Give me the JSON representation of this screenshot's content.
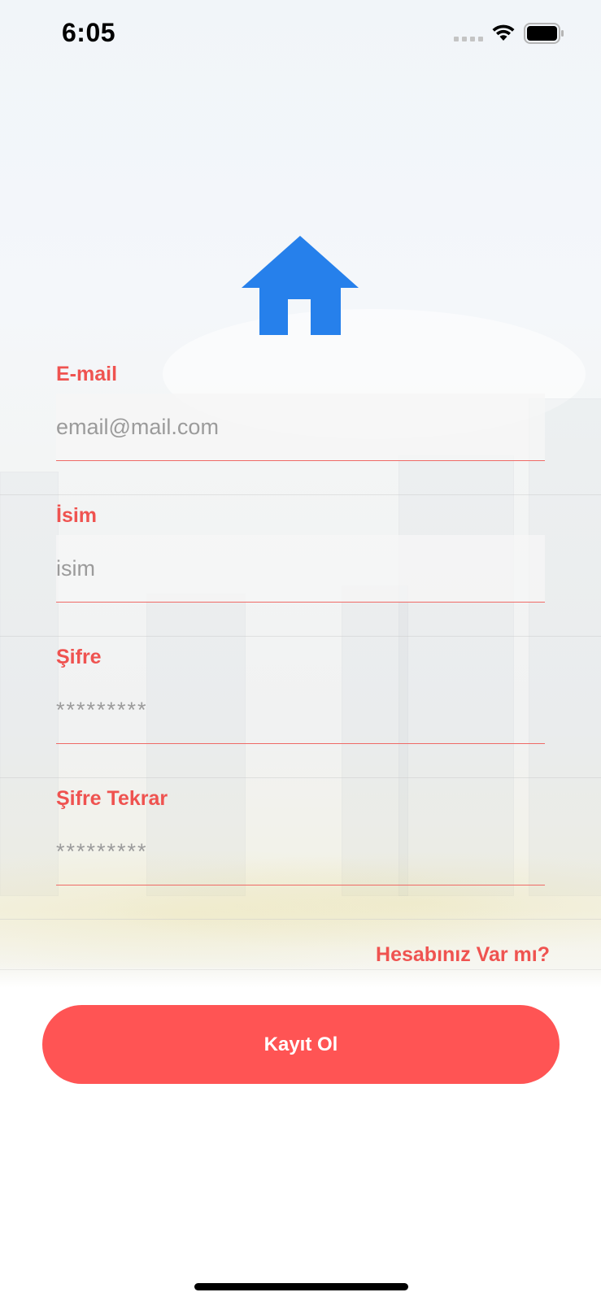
{
  "status_bar": {
    "time": "6:05"
  },
  "icons": {
    "logo": "home-icon",
    "signal": "cellular-signal-icon",
    "wifi": "wifi-icon",
    "battery": "battery-icon"
  },
  "colors": {
    "accent": "#ef5350",
    "button": "#ff5454",
    "logo": "#2680eb"
  },
  "form": {
    "email": {
      "label": "E-mail",
      "placeholder": "email@mail.com",
      "value": ""
    },
    "name": {
      "label": "İsim",
      "placeholder": "isim",
      "value": ""
    },
    "password": {
      "label": "Şifre",
      "placeholder": "*********",
      "value": ""
    },
    "password_repeat": {
      "label": "Şifre Tekrar",
      "placeholder": "*********",
      "value": ""
    }
  },
  "login_link": "Hesabınız Var mı?",
  "register_button": "Kayıt Ol"
}
